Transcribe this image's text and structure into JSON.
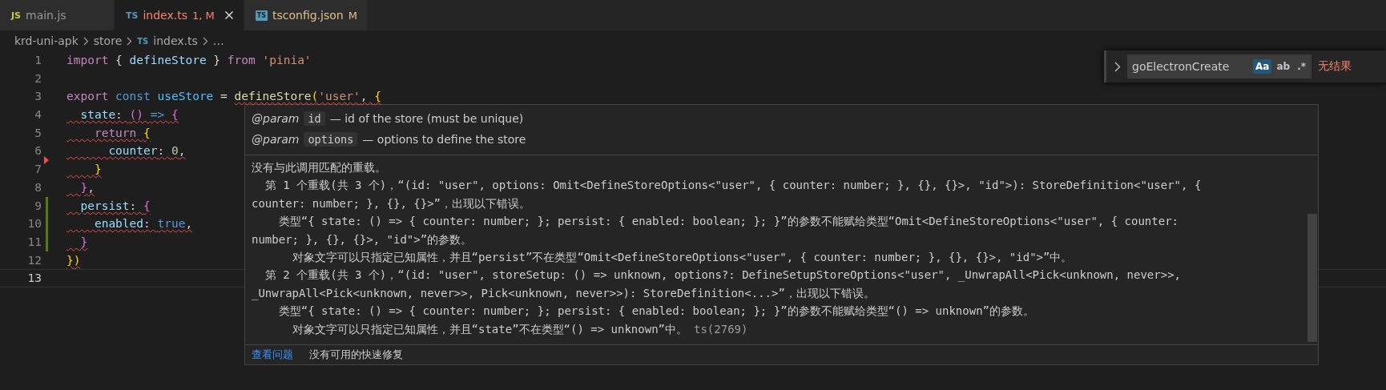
{
  "tabs": [
    {
      "icon_text": "JS",
      "kind": "js",
      "label": "main.js",
      "selected": false,
      "has_error": false,
      "modified": false
    },
    {
      "icon_text": "TS",
      "kind": "ts",
      "label": "index.ts",
      "badge": "1, M",
      "selected": true,
      "has_error": true
    },
    {
      "icon_text": "TS",
      "kind": "tsconfig",
      "label": "tsconfig.json",
      "badge": "M",
      "selected": false,
      "has_error": false,
      "modified": true
    }
  ],
  "breadcrumb": {
    "items": [
      {
        "label": "krd-uni-apk"
      },
      {
        "label": "store"
      },
      {
        "icon_text": "TS",
        "label": "index.ts"
      },
      {
        "label": "…"
      }
    ]
  },
  "editor": {
    "lines": [
      {
        "number": "1",
        "current": false,
        "added": false,
        "deleted": false,
        "segments": [
          {
            "error": false,
            "tokens": [
              {
                "text": "import",
                "kind": "kw"
              },
              {
                "text": " { ",
                "kind": "p"
              },
              {
                "text": "defineStore",
                "kind": "var"
              },
              {
                "text": " } ",
                "kind": "p"
              },
              {
                "text": "from ",
                "kind": "kw"
              },
              {
                "text": "'pinia'",
                "kind": "str"
              }
            ]
          }
        ]
      },
      {
        "number": "2",
        "current": false,
        "added": false,
        "deleted": false
      },
      {
        "number": "3",
        "current": false,
        "added": false,
        "deleted": false,
        "segments": [
          {
            "error": false,
            "tokens": [
              {
                "text": "export ",
                "kind": "kw"
              },
              {
                "text": "const ",
                "kind": "stor"
              },
              {
                "text": "useStore",
                "kind": "cvar"
              },
              {
                "text": " = ",
                "kind": "p"
              }
            ]
          },
          {
            "error": true,
            "tokens": [
              {
                "text": "defineStore",
                "kind": "fn"
              },
              {
                "text": "(",
                "kind": "b1"
              },
              {
                "text": "'user'",
                "kind": "str"
              },
              {
                "text": ", ",
                "kind": "p"
              },
              {
                "text": "{",
                "kind": "b1"
              }
            ]
          }
        ]
      },
      {
        "number": "4",
        "current": false,
        "added": false,
        "deleted": false,
        "segments": [
          {
            "error": true,
            "tokens": [
              {
                "text": "  state",
                "kind": "var"
              },
              {
                "text": ": ",
                "kind": "p"
              },
              {
                "text": "() ",
                "kind": "b2"
              },
              {
                "text": "=> ",
                "kind": "stor"
              },
              {
                "text": "{",
                "kind": "b2"
              }
            ]
          }
        ]
      },
      {
        "number": "5",
        "current": false,
        "added": false,
        "deleted": false,
        "segments": [
          {
            "error": true,
            "tokens": [
              {
                "text": "    return ",
                "kind": "kw"
              },
              {
                "text": "{",
                "kind": "b1"
              }
            ]
          }
        ]
      },
      {
        "number": "6",
        "current": false,
        "added": false,
        "deleted": false,
        "segments": [
          {
            "error": true,
            "tokens": [
              {
                "text": "      counter",
                "kind": "var"
              },
              {
                "text": ": ",
                "kind": "p"
              },
              {
                "text": "0",
                "kind": "num"
              },
              {
                "text": ",",
                "kind": "p"
              }
            ]
          }
        ]
      },
      {
        "number": "7",
        "current": false,
        "added": false,
        "deleted": true,
        "segments": [
          {
            "error": true,
            "tokens": [
              {
                "text": "    }",
                "kind": "b1"
              }
            ]
          }
        ]
      },
      {
        "number": "8",
        "current": false,
        "added": false,
        "deleted": false,
        "segments": [
          {
            "error": true,
            "tokens": [
              {
                "text": "  }",
                "kind": "b2"
              },
              {
                "text": ",",
                "kind": "p"
              }
            ]
          }
        ]
      },
      {
        "number": "9",
        "current": false,
        "added": true,
        "deleted": false,
        "segments": [
          {
            "error": true,
            "tokens": [
              {
                "text": "  persist",
                "kind": "var"
              },
              {
                "text": ": ",
                "kind": "p"
              },
              {
                "text": "{",
                "kind": "b2"
              }
            ]
          }
        ]
      },
      {
        "number": "10",
        "current": false,
        "added": true,
        "deleted": false,
        "segments": [
          {
            "error": true,
            "tokens": [
              {
                "text": "    enabled",
                "kind": "var"
              },
              {
                "text": ": ",
                "kind": "p"
              },
              {
                "text": "true",
                "kind": "stor"
              },
              {
                "text": ",",
                "kind": "p"
              }
            ]
          }
        ]
      },
      {
        "number": "11",
        "current": false,
        "added": true,
        "deleted": false,
        "segments": [
          {
            "error": true,
            "tokens": [
              {
                "text": "  }",
                "kind": "b2"
              }
            ]
          }
        ]
      },
      {
        "number": "12",
        "current": false,
        "added": false,
        "deleted": false,
        "segments": [
          {
            "error": true,
            "tokens": [
              {
                "text": "}",
                "kind": "b1"
              },
              {
                "text": ")",
                "kind": "b1"
              }
            ]
          }
        ]
      },
      {
        "number": "13",
        "current": true,
        "added": false,
        "deleted": false
      }
    ]
  },
  "hover": {
    "params": [
      {
        "tag": "@param",
        "name": "id",
        "description": "— id of the store (must be unique)"
      },
      {
        "tag": "@param",
        "name": "options",
        "description": "— options to define the store"
      }
    ],
    "error_lines": [
      "没有与此调用匹配的重载。",
      "  第 1 个重载(共 3 个)，“(id: \"user\", options: Omit<DefineStoreOptions<\"user\", { counter: number; }, {}, {}>, \"id\">): StoreDefinition<\"user\", {",
      "counter: number; }, {}, {}>”，出现以下错误。",
      "    类型“{ state: () => { counter: number; }; persist: { enabled: boolean; }; }”的参数不能赋给类型“Omit<DefineStoreOptions<\"user\", { counter:",
      "number; }, {}, {}>, \"id\">”的参数。",
      "      对象文字可以只指定已知属性，并且“persist”不在类型“Omit<DefineStoreOptions<\"user\", { counter: number; }, {}, {}>, \"id\">”中。",
      "  第 2 个重载(共 3 个)，“(id: \"user\", storeSetup: () => unknown, options?: DefineSetupStoreOptions<\"user\", _UnwrapAll<Pick<unknown, never>>,",
      "_UnwrapAll<Pick<unknown, never>>, Pick<unknown, never>>): StoreDefinition<...>”，出现以下错误。",
      "    类型“{ state: () => { counter: number; }; persist: { enabled: boolean; }; }”的参数不能赋给类型“() => unknown”的参数。",
      "      对象文字可以只指定已知属性，并且“state”不在类型“() => unknown”中。"
    ],
    "error_code": "ts(2769)",
    "footer": {
      "link": "查看问题",
      "note": "没有可用的快速修复"
    }
  },
  "find": {
    "replace_expanded": false,
    "value": "goElectronCreate",
    "toggles": [
      {
        "label": "Aa",
        "selected": true
      },
      {
        "label": "ab",
        "selected": false
      },
      {
        "label": ".*",
        "selected": false
      }
    ],
    "result": "无结果"
  }
}
